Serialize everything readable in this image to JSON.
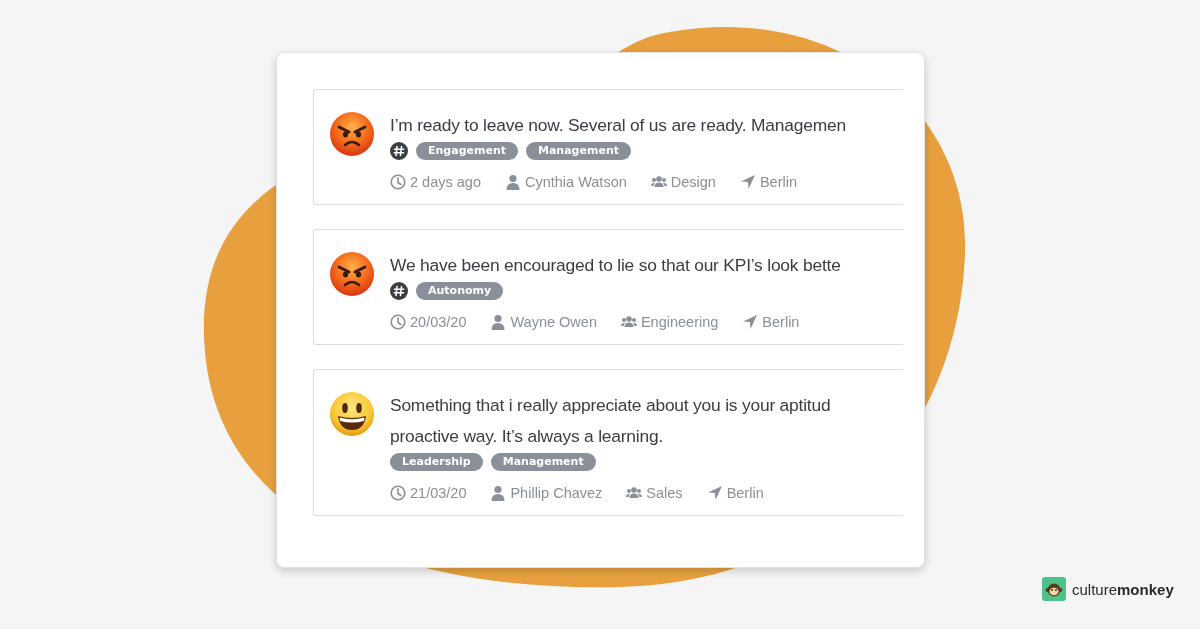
{
  "feed": [
    {
      "kind": "angry",
      "lines": [
        "I’m ready to leave now. Several of us are ready. Managemen"
      ],
      "channel": true,
      "tags": [
        "Engagement",
        "Management"
      ],
      "time": "2 days ago",
      "person": "Cynthia Watson",
      "team": "Design",
      "location": "Berlin"
    },
    {
      "kind": "angry",
      "lines": [
        "We have been encouraged to lie so that our KPI’s look bette"
      ],
      "channel": true,
      "tags": [
        "Autonomy"
      ],
      "time": "20/03/20",
      "person": "Wayne Owen",
      "team": "Engineering",
      "location": "Berlin"
    },
    {
      "kind": "happy",
      "lines": [
        "Something that i really appreciate about you is your aptitud",
        "proactive way. It’s always a learning."
      ],
      "channel": false,
      "tags": [
        "Leadership",
        "Management"
      ],
      "time": "21/03/20",
      "person": "Phillip Chavez",
      "team": "Sales",
      "location": "Berlin"
    }
  ],
  "brand": {
    "name": "culture**monkey**"
  }
}
